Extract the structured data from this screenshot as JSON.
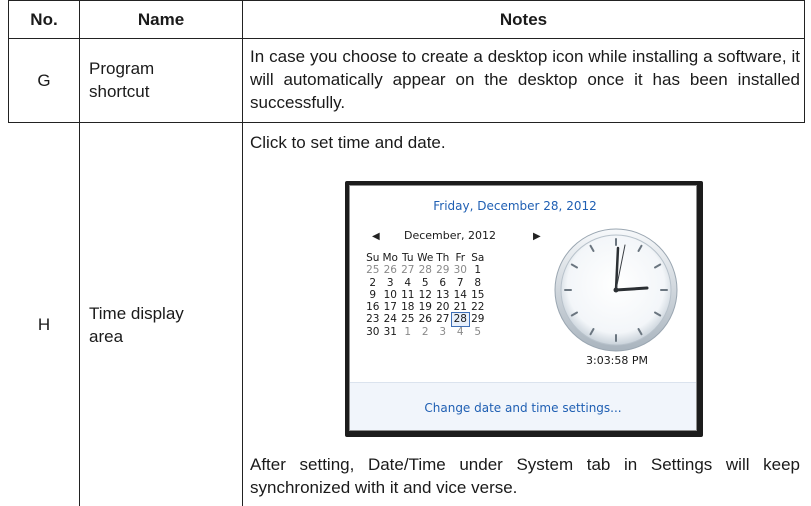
{
  "headers": {
    "no": "No.",
    "name": "Name",
    "notes": "Notes"
  },
  "rows": [
    {
      "no": "G",
      "name_lines": [
        "Program",
        "shortcut"
      ],
      "notes": "In case you choose to create a desktop icon while installing a software, it will automatically appear on the desktop once it has been installed successfully."
    },
    {
      "no": "H",
      "name_lines": [
        "Time display",
        "area"
      ],
      "notes_before": "Click to set time and date.",
      "notes_after": "After setting, Date/Time under System tab in Settings will keep synchronized with it and vice verse."
    }
  ],
  "calendar_popup": {
    "full_date": "Friday, December 28, 2012",
    "prev_icon": "left-triangle",
    "next_icon": "right-triangle",
    "month_title": "December, 2012",
    "weekdays": [
      "Su",
      "Mo",
      "Tu",
      "We",
      "Th",
      "Fr",
      "Sa"
    ],
    "weeks": [
      [
        "25",
        "26",
        "27",
        "28",
        "29",
        "30",
        "1"
      ],
      [
        "2",
        "3",
        "4",
        "5",
        "6",
        "7",
        "8"
      ],
      [
        "9",
        "10",
        "11",
        "12",
        "13",
        "14",
        "15"
      ],
      [
        "16",
        "17",
        "18",
        "19",
        "20",
        "21",
        "22"
      ],
      [
        "23",
        "24",
        "25",
        "26",
        "27",
        "28",
        "29"
      ],
      [
        "30",
        "31",
        "1",
        "2",
        "3",
        "4",
        "5"
      ]
    ],
    "clock_time": "3:03:58 PM",
    "footer_link": "Change date and time settings...",
    "accent_color": "#1f5fb3"
  }
}
